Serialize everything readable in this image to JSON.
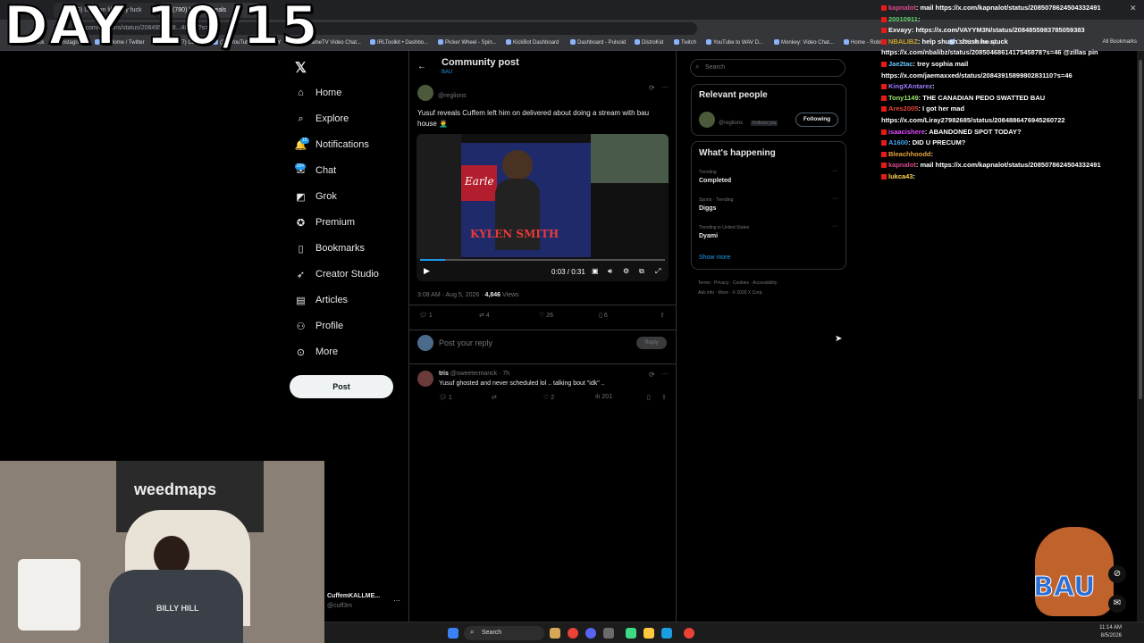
{
  "overlay": {
    "day": "DAY 10/15"
  },
  "browser": {
    "tabs": [
      "(780) Lilbz on lilbeezy fuck",
      "(780) Yusuf reveals"
    ],
    "url": "x.com/reglions/status/2084959638...48343?s=46",
    "bookmarks": [
      "Kick",
      "Instagram",
      "(1) Home / Twitter",
      "(77) Cuffem",
      "(37) YouTube",
      "BO KEY",
      "NameTV Video Chat...",
      "IRLToolkit • Dashbo...",
      "Picker Wheel - Spin...",
      "KickBot Dashboard",
      "Dashboard - Pulsoid",
      "DistroKid",
      "Twitch",
      "YouTube to WAV D...",
      "Monkey: Video Chat...",
      "Home - Roblox",
      "C 326: Holloway..."
    ],
    "all_bookmarks": "All Bookmarks"
  },
  "nav": {
    "items": [
      "Home",
      "Explore",
      "Notifications",
      "Chat",
      "Grok",
      "Premium",
      "Bookmarks",
      "Creator Studio",
      "Articles",
      "Profile",
      "More"
    ],
    "post": "Post",
    "notif_badge": "15",
    "chat_badge": "20+",
    "account_name": "CuffemKALLME...",
    "account_handle": "@cuff3m"
  },
  "post": {
    "header_title": "Community post",
    "header_sub": "BAU",
    "author_handle": "@reglions",
    "text": "Yusuf reveals Cuffem left him on delivered about doing a stream with bau house 🤦‍♂️",
    "video_title": "Earle",
    "video_name": "KYLEN SMITH",
    "video_time": "0:03 / 0:31",
    "timestamp": "3:08 AM · Aug 5, 2026 · ",
    "views_num": "4,846",
    "views_label": "Views",
    "replies": "1",
    "reposts": "4",
    "likes": "26",
    "bookmarks": "6",
    "reply_placeholder": "Post your reply",
    "reply_button": "Reply"
  },
  "reply": {
    "name": "tris",
    "handle": "@sweetermanck · 7h",
    "text": "Yusuf ghosted and never scheduled lol .. talking bout \"idk\" ..",
    "replies": "1",
    "likes": "2",
    "views": "201"
  },
  "right": {
    "search_placeholder": "Search",
    "relevant_title": "Relevant people",
    "relevant_handle": "@reglions",
    "follows_you": "Follows you",
    "following_btn": "Following",
    "happening_title": "What's happening",
    "trends": [
      {
        "meta": "Trending",
        "name": "Completed"
      },
      {
        "meta": "Sports · Trending",
        "name": "Diggs"
      },
      {
        "meta": "Trending in United States",
        "name": "Dyami"
      }
    ],
    "show_more": "Show more",
    "footer1": "Terms · Privacy · Cookies · Accessibility ·",
    "footer2": "Ads info · More · © 2026 X Corp."
  },
  "chat": [
    {
      "user": "kapnalot",
      "color": "#d9498a",
      "msg": "mail https://x.com/kapnalot/status/2085078624504332491"
    },
    {
      "user": "20010911",
      "color": "#62d26f",
      "msg": ""
    },
    {
      "user": "Exvayy",
      "color": "#ffffff",
      "msg": "https://x.com/VAYYM3N/status/2084855983785059383"
    },
    {
      "user": "NBALIBZ",
      "color": "#c9a227",
      "msg": "help shush shush he stuck"
    },
    {
      "user": "",
      "color": "#ffffff",
      "msg": "https://x.com/nbalibz/status/2085046861417545878?s=46 @zillas pin"
    },
    {
      "user": "Jae2tac",
      "color": "#66c7ff",
      "msg": "trey sophia mail"
    },
    {
      "user": "",
      "color": "#ffffff",
      "msg": "https://x.com/jaemaxxed/status/2084391589980283110?s=46"
    },
    {
      "user": "KingXAntarez",
      "color": "#9d7bff",
      "msg": ""
    },
    {
      "user": "Tony1149",
      "color": "#9ce56b",
      "msg": "THE CANADIAN PEDO SWATTED BAU"
    },
    {
      "user": "Ares2005",
      "color": "#e6473a",
      "msg": "I got her mad"
    },
    {
      "user": "",
      "color": "#ffffff",
      "msg": "https://x.com/Liray27982685/status/2084886476945260722"
    },
    {
      "user": "isaacishere",
      "color": "#e14cff",
      "msg": "ABANDONED SPOT TODAY?"
    },
    {
      "user": "A1600",
      "color": "#3fa9f5",
      "msg": "DID U PRECUM?"
    },
    {
      "user": "Bleachhoodd",
      "color": "#e8a33c",
      "msg": ""
    },
    {
      "user": "kapnalot",
      "color": "#d9498a",
      "msg": "mail https://x.com/kapnalot/status/2085078624504332491"
    },
    {
      "user": "lukca43",
      "color": "#ffd34d",
      "msg": ""
    }
  ],
  "webcam": {
    "banner": "weedmaps",
    "shirt": "BILLY HILL"
  },
  "streamer_logo": "BAU",
  "taskbar": {
    "search": "Search",
    "time": "11:14 AM",
    "date": "8/5/2026"
  },
  "colors": {
    "accent": "#1d9bf0",
    "bg": "#000000",
    "border": "#2f3336"
  }
}
